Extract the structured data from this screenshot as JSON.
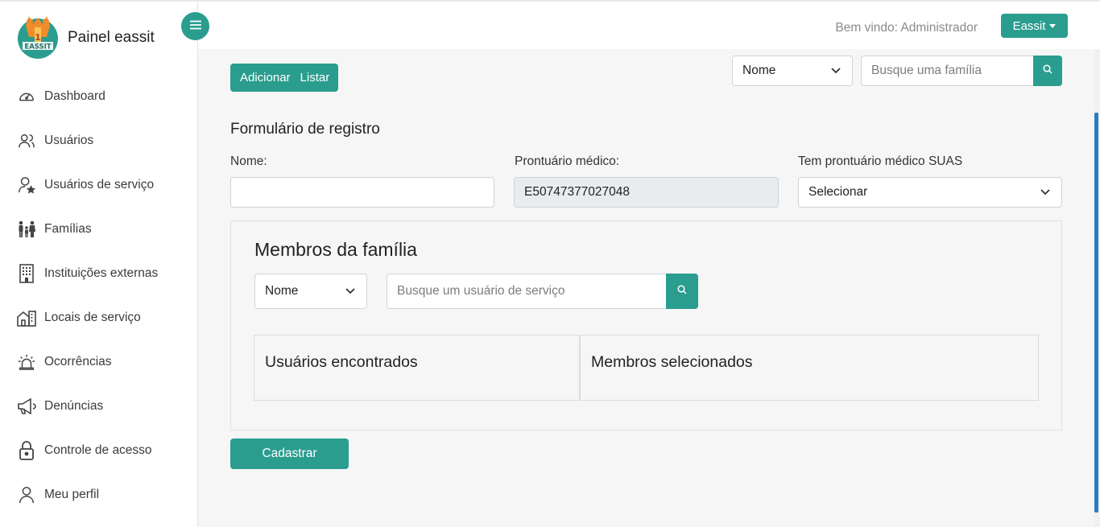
{
  "app": {
    "title": "Painel eassit",
    "logo_text": "EASSIT"
  },
  "colors": {
    "accent": "#2a9d8f",
    "sidebar_bg": "#ffffff",
    "main_bg": "#f6f6f6"
  },
  "sidebar": {
    "items": [
      {
        "label": "Dashboard",
        "icon": "gauge-icon"
      },
      {
        "label": "Usuários",
        "icon": "users-icon"
      },
      {
        "label": "Usuários de serviço",
        "icon": "user-star-icon"
      },
      {
        "label": "Famílias",
        "icon": "family-icon"
      },
      {
        "label": "Instituições externas",
        "icon": "building-icon"
      },
      {
        "label": "Locais de serviço",
        "icon": "buildings-icon"
      },
      {
        "label": "Ocorrências",
        "icon": "alarm-icon"
      },
      {
        "label": "Denúncias",
        "icon": "megaphone-icon"
      },
      {
        "label": "Controle de acesso",
        "icon": "lock-icon"
      },
      {
        "label": "Meu perfil",
        "icon": "person-icon"
      }
    ]
  },
  "header": {
    "welcome": "Bem vindo: Administrador",
    "user_menu": "Eassit"
  },
  "toolbar": {
    "add_label": "Adicionar",
    "list_label": "Listar",
    "filter_value": "Nome",
    "search_placeholder": "Busque uma família"
  },
  "form": {
    "title": "Formulário de registro",
    "name_label": "Nome:",
    "name_value": "",
    "record_label": "Prontuário médico:",
    "record_value": "E50747377027048",
    "suas_label": "Tem prontuário médico SUAS",
    "suas_value": "Selecionar"
  },
  "members": {
    "title": "Membros da família",
    "filter_value": "Nome",
    "search_placeholder": "Busque um usuário de serviço",
    "found_heading": "Usuários encontrados",
    "selected_heading": "Membros selecionados"
  },
  "submit_label": "Cadastrar"
}
